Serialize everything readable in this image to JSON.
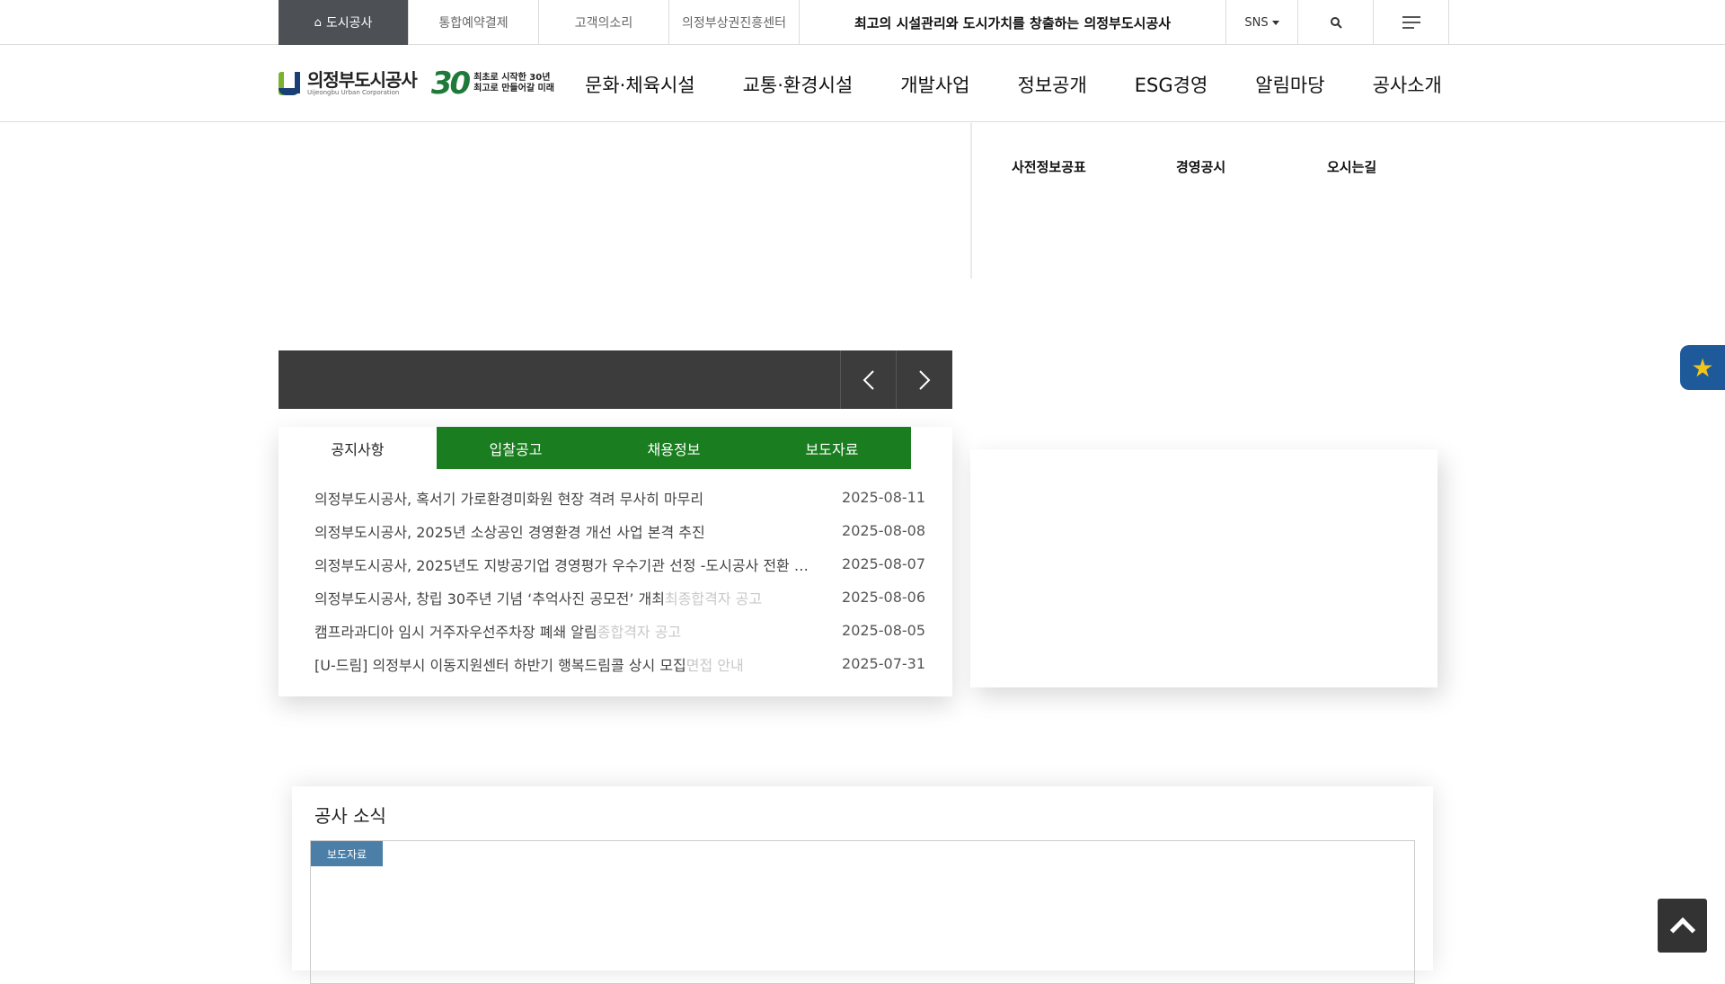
{
  "topbar": {
    "items": [
      "도시공사",
      "통합예약결제",
      "고객의소리",
      "의정부상권진흥센터"
    ],
    "slogan": "최고의 시설관리와 도시가치를 창출하는 의정부도시공사",
    "sns": "SNS"
  },
  "header": {
    "logo_name": "의정부도시공사",
    "logo_sub": "Uijeongbu Urban Corporation",
    "logo_30_num": "30",
    "logo_30_line1": "최초로 시작한 30년",
    "logo_30_line2": "최고로 만들어갈 미래",
    "nav": [
      "문화·체육시설",
      "교통·환경시설",
      "개발사업",
      "정보공개",
      "ESG경영",
      "알림마당",
      "공사소개"
    ]
  },
  "quick_links": [
    "사전정보공표",
    "경영공시",
    "오시는길"
  ],
  "board": {
    "tabs": [
      "공지사항",
      "입찰공고",
      "채용정보",
      "보도자료"
    ],
    "rows": [
      {
        "title": "의정부도시공사, 혹서기 가로환경미화원 현장 격려 무사히 마무리",
        "ghost": "",
        "date": "2025-08-11"
      },
      {
        "title": "의정부도시공사, 2025년 소상공인 경영환경 개선 사업 본격 추진",
        "ghost": "",
        "date": "2025-08-08"
      },
      {
        "title": "의정부도시공사, 2025년도 지방공기업 경영평가 우수기관 선정 -도시공사 전환 …",
        "ghost": "",
        "date": "2025-08-07"
      },
      {
        "title": "의정부도시공사, 창립 30주년 기념 ‘추억사진 공모전’ 개최",
        "ghost": "최종합격자 공고",
        "date": "2025-08-06"
      },
      {
        "title": "캠프라과디아 임시 거주자우선주차장 폐쇄 알림",
        "ghost": "종합격자 공고",
        "date": "2025-08-05"
      },
      {
        "title": "[U-드림] 의정부시 이동지원센터 하반기 행복드림콜 상시 모집",
        "ghost": "면접 안내",
        "date": "2025-07-31"
      }
    ]
  },
  "news": {
    "title": "공사 소식",
    "badge": "보도자료"
  },
  "icons": {
    "home": "home-icon",
    "search": "search-icon",
    "menu": "menu-icon",
    "prev": "chevron-left-icon",
    "next": "chevron-right-icon",
    "star": "star-icon",
    "top": "chevron-up-icon"
  },
  "colors": {
    "tab_green": "#1a7d1f",
    "topbar_active": "#4d5155",
    "badge_blue": "#4b7fa8",
    "fav_blue": "#1e5a9a"
  }
}
